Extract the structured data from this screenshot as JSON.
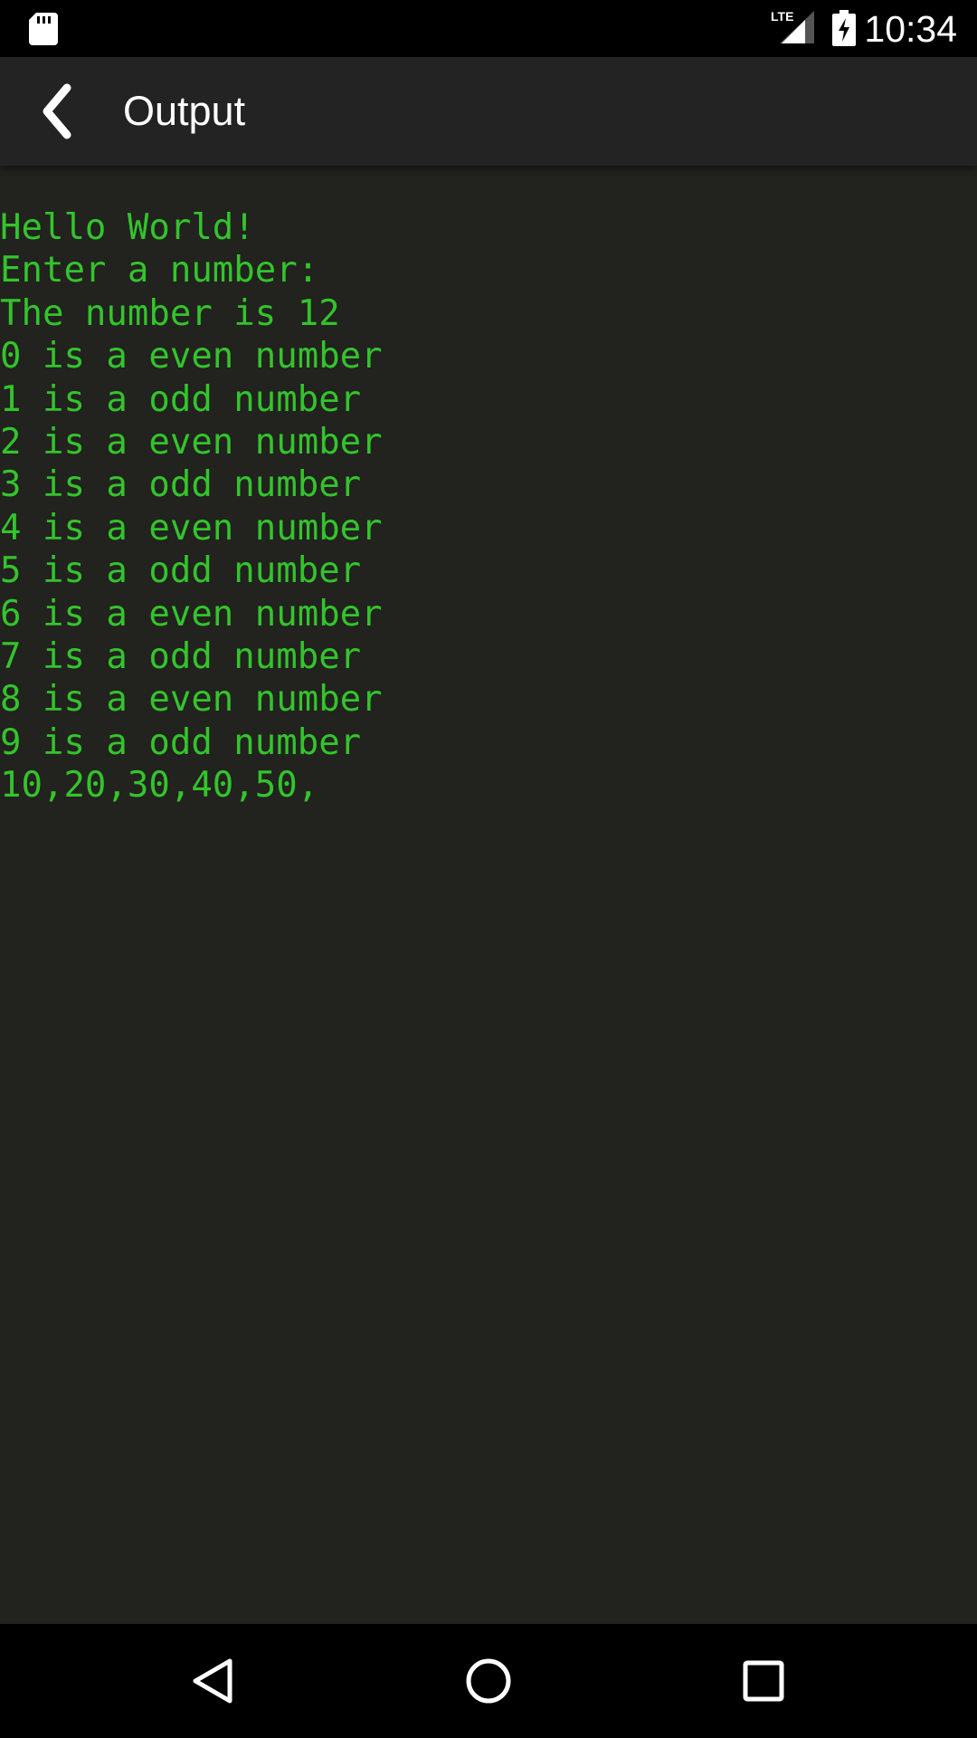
{
  "status_bar": {
    "time": "10:34",
    "network_label": "LTE",
    "icons": [
      "sd-card-icon",
      "lte-signal-icon",
      "battery-charging-icon"
    ]
  },
  "app_bar": {
    "title": "Output",
    "back_icon": "chevron-left-icon"
  },
  "console": {
    "lines": [
      "Hello World!",
      "Enter a number:",
      "The number is 12",
      "0 is a even number",
      "1 is a odd number",
      "2 is a even number",
      "3 is a odd number",
      "4 is a even number",
      "5 is a odd number",
      "6 is a even number",
      "7 is a odd number",
      "8 is a even number",
      "9 is a odd number",
      "10,20,30,40,50,"
    ]
  },
  "nav_bar": {
    "icons": [
      "nav-back-icon",
      "nav-home-icon",
      "nav-recents-icon"
    ]
  },
  "colors": {
    "status_bar_bg": "#000000",
    "app_bar_bg": "#232323",
    "console_bg": "#22221e",
    "console_text": "#33c42c",
    "nav_bar_bg": "#000000"
  }
}
